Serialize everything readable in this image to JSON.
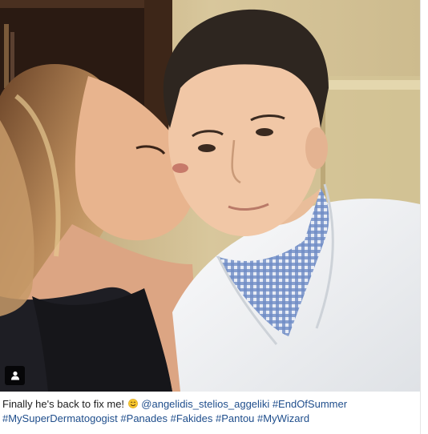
{
  "photo": {
    "description_icon": "people-tag-icon",
    "colors": {
      "wall": "#cdb98d",
      "shelf": "#3a2418",
      "coat": "#f4f5f6",
      "shirt": "#5d7ab8",
      "skin": "#f0c5a5",
      "hair_man": "#2e2620",
      "hair_woman": "#a07048",
      "dress": "#1d1d22"
    }
  },
  "caption": {
    "text": "Finally he's back to fix me!",
    "emoji": "smiling-face-emoji",
    "mention": "@angelidis_stelios_aggeliki",
    "hashtags": [
      "#EndOfSummer",
      "#MySuperDermatogogist",
      "#Panades",
      "#Fakides",
      "#Pantou",
      "#MyWizard"
    ]
  },
  "accent_colors": {
    "link": "#1f4e8c",
    "text": "#1c1c1c"
  }
}
